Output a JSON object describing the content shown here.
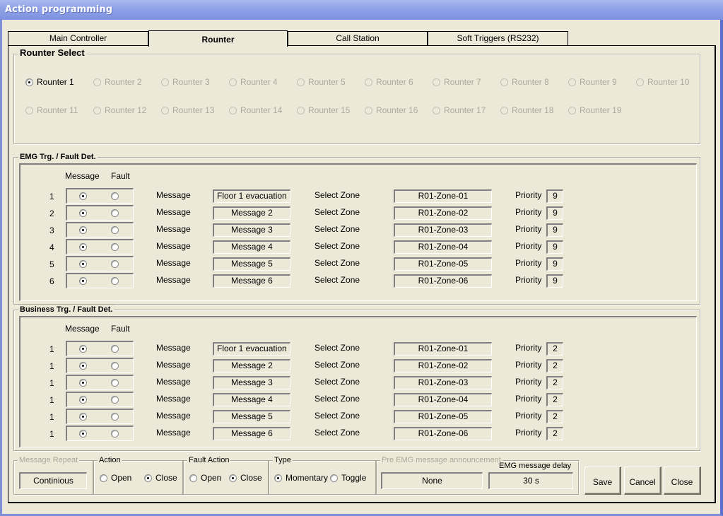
{
  "window": {
    "title": "Action programming"
  },
  "tabs": [
    {
      "label": "Main Controller",
      "active": false
    },
    {
      "label": "Rounter",
      "active": true
    },
    {
      "label": "Call Station",
      "active": false
    },
    {
      "label": "Soft Triggers (RS232)",
      "active": false
    }
  ],
  "router_select": {
    "title": "Rounter Select",
    "selected": "Rounter 1",
    "options": [
      "Rounter 1",
      "Rounter 2",
      "Rounter 3",
      "Rounter 4",
      "Rounter 5",
      "Rounter 6",
      "Rounter 7",
      "Rounter 8",
      "Rounter 9",
      "Rounter 10",
      "Rounter 11",
      "Rounter 12",
      "Rounter 13",
      "Rounter 14",
      "Rounter 15",
      "Rounter 16",
      "Rounter 17",
      "Rounter 18",
      "Rounter 19"
    ]
  },
  "emg": {
    "title": "EMG Trg. / Fault Det.",
    "col_message": "Message",
    "col_fault": "Fault",
    "message_label": "Message",
    "zone_label": "Select Zone",
    "priority_label": "Priority",
    "rows": [
      {
        "index": "1",
        "mode": "Message",
        "message": "Floor 1 evacuation",
        "zone": "R01-Zone-01",
        "priority": "9"
      },
      {
        "index": "2",
        "mode": "Message",
        "message": "Message 2",
        "zone": "R01-Zone-02",
        "priority": "9"
      },
      {
        "index": "3",
        "mode": "Message",
        "message": "Message 3",
        "zone": "R01-Zone-03",
        "priority": "9"
      },
      {
        "index": "4",
        "mode": "Message",
        "message": "Message 4",
        "zone": "R01-Zone-04",
        "priority": "9"
      },
      {
        "index": "5",
        "mode": "Message",
        "message": "Message 5",
        "zone": "R01-Zone-05",
        "priority": "9"
      },
      {
        "index": "6",
        "mode": "Message",
        "message": "Message 6",
        "zone": "R01-Zone-06",
        "priority": "9"
      }
    ]
  },
  "business": {
    "title": "Business Trg. / Fault Det.",
    "col_message": "Message",
    "col_fault": "Fault",
    "message_label": "Message",
    "zone_label": "Select Zone",
    "priority_label": "Priority",
    "rows": [
      {
        "index": "1",
        "mode": "Message",
        "message": "Floor 1 evacuation",
        "zone": "R01-Zone-01",
        "priority": "2"
      },
      {
        "index": "1",
        "mode": "Message",
        "message": "Message 2",
        "zone": "R01-Zone-02",
        "priority": "2"
      },
      {
        "index": "1",
        "mode": "Message",
        "message": "Message 3",
        "zone": "R01-Zone-03",
        "priority": "2"
      },
      {
        "index": "1",
        "mode": "Message",
        "message": "Message 4",
        "zone": "R01-Zone-04",
        "priority": "2"
      },
      {
        "index": "1",
        "mode": "Message",
        "message": "Message 5",
        "zone": "R01-Zone-05",
        "priority": "2"
      },
      {
        "index": "1",
        "mode": "Message",
        "message": "Message 6",
        "zone": "R01-Zone-06",
        "priority": "2"
      }
    ]
  },
  "bottom": {
    "message_repeat": {
      "title": "Message Repeat",
      "value": "Continious"
    },
    "action": {
      "title": "Action",
      "options": [
        "Open",
        "Close"
      ],
      "selected": "Close"
    },
    "fault_action": {
      "title": "Fault Action",
      "options": [
        "Open",
        "Close"
      ],
      "selected": "Close"
    },
    "type": {
      "title": "Type",
      "options": [
        "Momentary",
        "Toggle"
      ],
      "selected": "Momentary"
    },
    "pre_emg": {
      "title": "Pre EMG message announcement",
      "value": "None"
    },
    "emg_delay": {
      "title": "EMG message delay",
      "value": "30 s"
    }
  },
  "buttons": {
    "save": "Save",
    "cancel": "Cancel",
    "close": "Close"
  }
}
